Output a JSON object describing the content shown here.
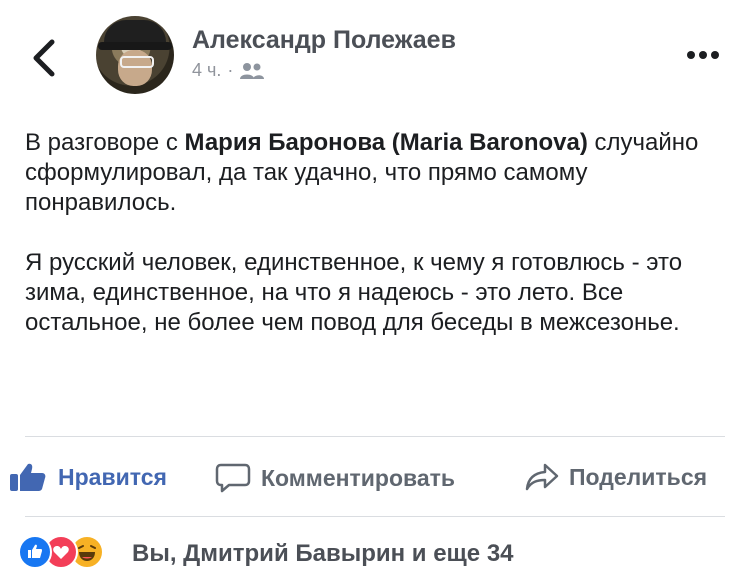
{
  "header": {
    "author_name": "Александр Полежаев",
    "time": "4 ч.",
    "separator": "·",
    "back_icon": "chevron-left-icon",
    "privacy_icon": "friends-icon",
    "more_icon": "ellipsis-icon"
  },
  "post": {
    "p1_prefix": "В разговоре с ",
    "p1_mention": "Мария Баронова (Maria Baronova)",
    "p1_suffix": " случайно сформулировал, да так удачно, что прямо самому понравилось.",
    "p2": "Я русский человек, единственное, к чему я готовлюсь - это зима, единственное, на что я надеюсь - это лето. Все остальное, не более чем повод для беседы в межсезонье."
  },
  "actions": {
    "like_label": "Нравится",
    "comment_label": "Комментировать",
    "share_label": "Поделиться"
  },
  "reactions": {
    "summary": "Вы, Дмитрий Бавырин и еще 34",
    "items": [
      "like-icon",
      "love-icon",
      "haha-icon"
    ]
  },
  "colors": {
    "accent": "#4267b2",
    "like_blue": "#1877f2",
    "love_red": "#f33e58",
    "haha_yellow": "#f7b125"
  }
}
